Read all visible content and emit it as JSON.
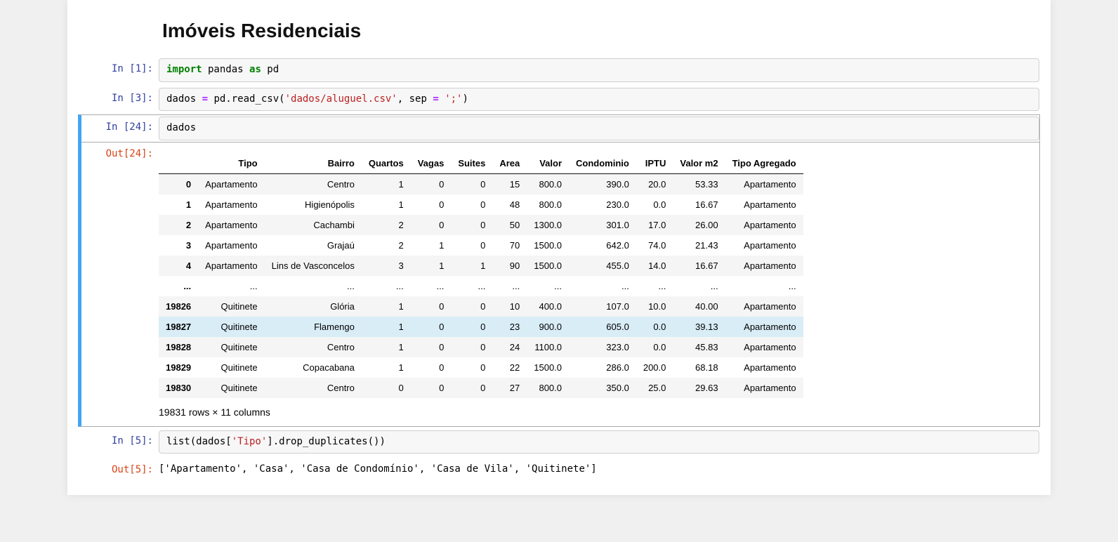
{
  "title": "Imóveis Residenciais",
  "cell1": {
    "prompt": "In [1]:",
    "code": {
      "kw_import": "import",
      "mod": " pandas ",
      "kw_as": "as",
      "alias": " pd"
    }
  },
  "cell3": {
    "prompt": "In [3]:",
    "code": {
      "pre": "dados ",
      "eq": "=",
      "mid": " pd.read_csv(",
      "str1": "'dados/aluguel.csv'",
      "comma": ", sep ",
      "eq2": "=",
      "sp": " ",
      "str2": "';'",
      "end": ")"
    }
  },
  "cell24": {
    "in_prompt": "In [24]:",
    "out_prompt": "Out[24]:",
    "code": "dados"
  },
  "df": {
    "columns": [
      "",
      "Tipo",
      "Bairro",
      "Quartos",
      "Vagas",
      "Suites",
      "Area",
      "Valor",
      "Condominio",
      "IPTU",
      "Valor m2",
      "Tipo Agregado"
    ],
    "rows_top": [
      [
        "0",
        "Apartamento",
        "Centro",
        "1",
        "0",
        "0",
        "15",
        "800.0",
        "390.0",
        "20.0",
        "53.33",
        "Apartamento"
      ],
      [
        "1",
        "Apartamento",
        "Higienópolis",
        "1",
        "0",
        "0",
        "48",
        "800.0",
        "230.0",
        "0.0",
        "16.67",
        "Apartamento"
      ],
      [
        "2",
        "Apartamento",
        "Cachambi",
        "2",
        "0",
        "0",
        "50",
        "1300.0",
        "301.0",
        "17.0",
        "26.00",
        "Apartamento"
      ],
      [
        "3",
        "Apartamento",
        "Grajaú",
        "2",
        "1",
        "0",
        "70",
        "1500.0",
        "642.0",
        "74.0",
        "21.43",
        "Apartamento"
      ],
      [
        "4",
        "Apartamento",
        "Lins de Vasconcelos",
        "3",
        "1",
        "1",
        "90",
        "1500.0",
        "455.0",
        "14.0",
        "16.67",
        "Apartamento"
      ]
    ],
    "ellipsis": [
      "...",
      "...",
      "...",
      "...",
      "...",
      "...",
      "...",
      "...",
      "...",
      "...",
      "...",
      "..."
    ],
    "rows_bottom": [
      [
        "19826",
        "Quitinete",
        "Glória",
        "1",
        "0",
        "0",
        "10",
        "400.0",
        "107.0",
        "10.0",
        "40.00",
        "Apartamento"
      ],
      [
        "19827",
        "Quitinete",
        "Flamengo",
        "1",
        "0",
        "0",
        "23",
        "900.0",
        "605.0",
        "0.0",
        "39.13",
        "Apartamento"
      ],
      [
        "19828",
        "Quitinete",
        "Centro",
        "1",
        "0",
        "0",
        "24",
        "1100.0",
        "323.0",
        "0.0",
        "45.83",
        "Apartamento"
      ],
      [
        "19829",
        "Quitinete",
        "Copacabana",
        "1",
        "0",
        "0",
        "22",
        "1500.0",
        "286.0",
        "200.0",
        "68.18",
        "Apartamento"
      ],
      [
        "19830",
        "Quitinete",
        "Centro",
        "0",
        "0",
        "0",
        "27",
        "800.0",
        "350.0",
        "25.0",
        "29.63",
        "Apartamento"
      ]
    ],
    "hover_bottom_index": 1,
    "summary": "19831 rows × 11 columns"
  },
  "cell5": {
    "in_prompt": "In [5]:",
    "out_prompt": "Out[5]:",
    "code": {
      "pre": "list(dados[",
      "str": "'Tipo'",
      "post": "].drop_duplicates())"
    },
    "output": "['Apartamento', 'Casa', 'Casa de Condomínio', 'Casa de Vila', 'Quitinete']"
  }
}
